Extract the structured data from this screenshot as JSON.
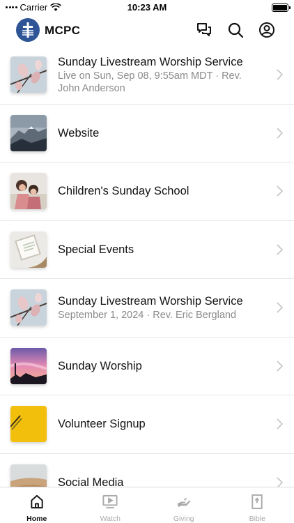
{
  "status_bar": {
    "carrier": "Carrier",
    "time": "10:23 AM"
  },
  "header": {
    "title": "MCPC",
    "logo_icon": "church-cross-logo",
    "actions": [
      "chat-bubbles-icon",
      "search-icon",
      "account-icon"
    ]
  },
  "items": [
    {
      "title": "Sunday Livestream Worship Service",
      "subtitle": "Live on Sun, Sep 08, 9:55am MDT · Rev. John Anderson",
      "thumbnail": "magnolia-blossoms"
    },
    {
      "title": "Website",
      "subtitle": "",
      "thumbnail": "mountain-landscape"
    },
    {
      "title": "Children's Sunday School",
      "subtitle": "",
      "thumbnail": "children-photo"
    },
    {
      "title": "Special Events",
      "subtitle": "",
      "thumbnail": "notebook-on-table"
    },
    {
      "title": "Sunday Livestream Worship Service",
      "subtitle": "September 1, 2024 · Rev. Eric Bergland",
      "thumbnail": "magnolia-blossoms"
    },
    {
      "title": "Sunday Worship",
      "subtitle": "",
      "thumbnail": "sunset-sky"
    },
    {
      "title": "Volunteer Signup",
      "subtitle": "",
      "thumbnail": "yellow-background"
    },
    {
      "title": "Social Media",
      "subtitle": "",
      "thumbnail": "desert-dunes"
    }
  ],
  "tabs": [
    {
      "label": "Home",
      "icon": "home-icon",
      "active": true
    },
    {
      "label": "Watch",
      "icon": "video-play-icon",
      "active": false
    },
    {
      "label": "Giving",
      "icon": "giving-hand-icon",
      "active": false
    },
    {
      "label": "Bible",
      "icon": "bible-icon",
      "active": false
    }
  ],
  "colors": {
    "brand": "#2f5597",
    "separator": "#e6e6e6",
    "subtitle": "#8a8a8a",
    "inactive_tab": "#aaaaaa"
  }
}
